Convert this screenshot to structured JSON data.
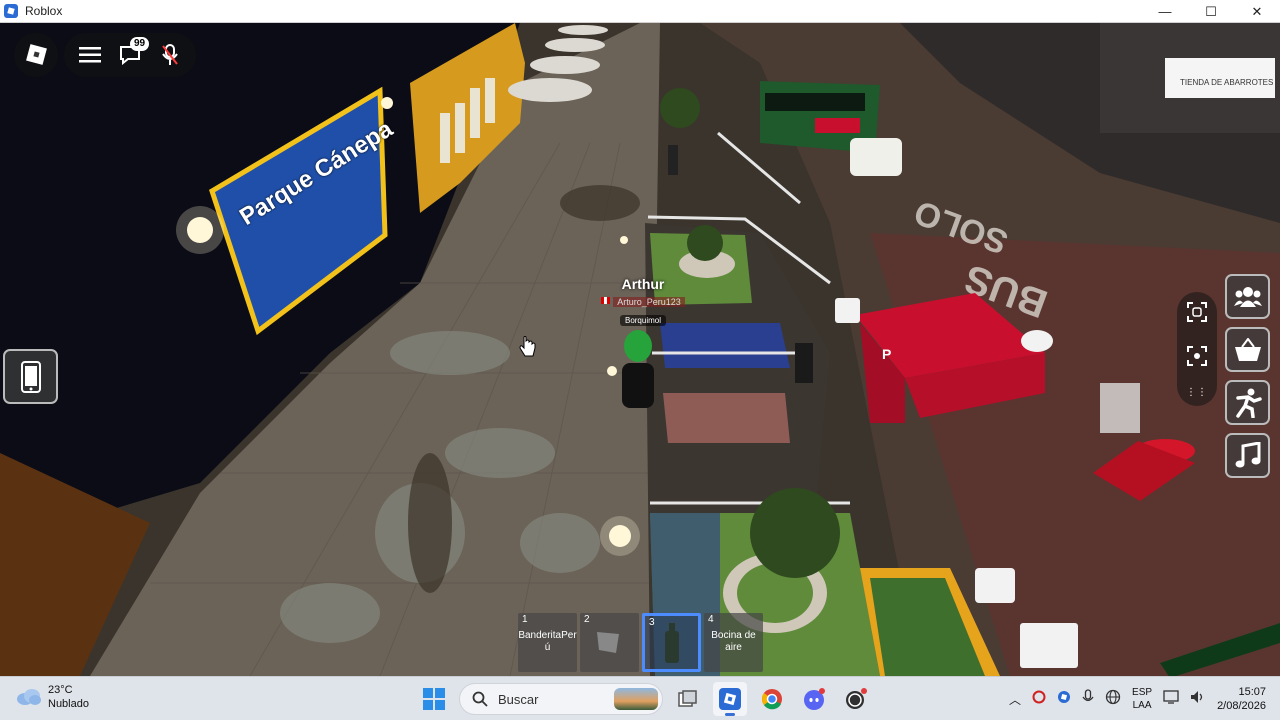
{
  "window": {
    "title": "Roblox",
    "controls": {
      "minimize": "—",
      "maximize": "☐",
      "close": "✕"
    }
  },
  "hud": {
    "chat_badge": "99",
    "icons": [
      "roblox-menu-icon",
      "hamburger-menu-icon",
      "chat-icon",
      "microphone-muted-icon"
    ]
  },
  "scene": {
    "billboard": "Parque Cánepa",
    "road_marking_1": "BUS",
    "road_marking_2": "SOLO",
    "shop_sign": "TIENDA DE ABARROTES"
  },
  "player": {
    "display_name": "Arthur",
    "username": "Arturo_Peru123",
    "role": "Borquimol"
  },
  "hotbar": [
    {
      "num": "1",
      "name": "BanderitaPerú",
      "selected": false
    },
    {
      "num": "2",
      "name": "",
      "selected": false
    },
    {
      "num": "3",
      "name": "",
      "selected": true
    },
    {
      "num": "4",
      "name": "Bocina de aire",
      "selected": false
    }
  ],
  "side_buttons": [
    "friends-icon",
    "shop-basket-icon",
    "emote-runner-icon",
    "music-note-icon"
  ],
  "taskbar": {
    "weather_temp": "23°C",
    "weather_desc": "Nublado",
    "search_placeholder": "Buscar",
    "language": "ESP",
    "keyboard": "LAA",
    "time": "15:07",
    "date": "2/08/2026"
  },
  "colors": {
    "accent": "#4d8cff",
    "billboard_blue": "#1f4fa8",
    "billboard_yellow": "#f2c21b",
    "tent_red": "#c8102e"
  }
}
